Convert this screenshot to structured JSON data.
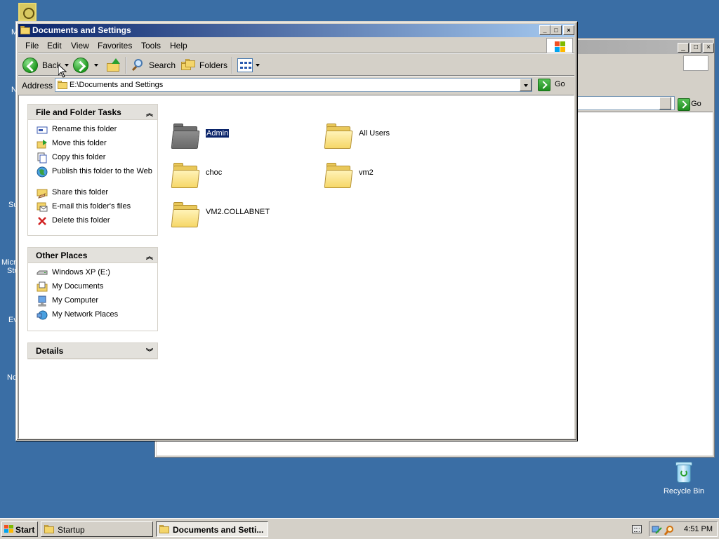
{
  "desktop": {
    "left_fragments": [
      "M",
      "N",
      "Su",
      "Micro",
      "Stu",
      "Ev",
      "No"
    ],
    "recycle_label": "Recycle Bin"
  },
  "window": {
    "title": "Documents and Settings",
    "menu": [
      "File",
      "Edit",
      "View",
      "Favorites",
      "Tools",
      "Help"
    ],
    "toolbar": {
      "back": "Back",
      "search": "Search",
      "folders": "Folders"
    },
    "address": {
      "label": "Address",
      "value": "E:\\Documents and Settings",
      "go": "Go"
    },
    "tasks_pane": {
      "title": "File and Folder Tasks",
      "items": [
        "Rename this folder",
        "Move this folder",
        "Copy this folder",
        "Publish this folder to the Web",
        "Share this folder",
        "E-mail this folder's files",
        "Delete this folder"
      ]
    },
    "places_pane": {
      "title": "Other Places",
      "items": [
        "Windows XP (E:)",
        "My Documents",
        "My Computer",
        "My Network Places"
      ]
    },
    "details_pane": {
      "title": "Details"
    },
    "folders": [
      "Admin",
      "All Users",
      "choc",
      "vm2",
      "VM2.COLLABNET"
    ],
    "selected_folder": "Admin"
  },
  "background_window": {
    "go": "Go"
  },
  "taskbar": {
    "start": "Start",
    "tasks": [
      "Startup",
      "Documents and Setti..."
    ],
    "clock": "4:51 PM"
  }
}
